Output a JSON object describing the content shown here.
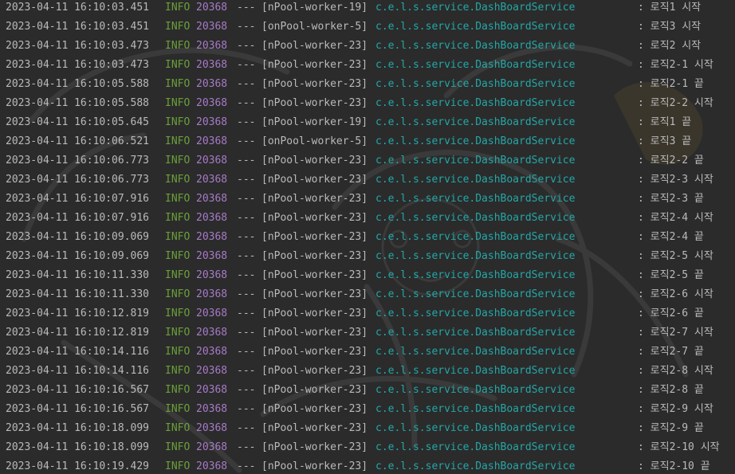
{
  "log": {
    "lines": [
      {
        "timestamp": "2023-04-11 16:10:03.451",
        "level": "INFO",
        "pid": "20368",
        "sep": "---",
        "thread": "[nPool-worker-19]",
        "logger": "c.e.l.s.service.DashBoardService",
        "message": ": 로직1 시작"
      },
      {
        "timestamp": "2023-04-11 16:10:03.451",
        "level": "INFO",
        "pid": "20368",
        "sep": "---",
        "thread": "[onPool-worker-5]",
        "logger": "c.e.l.s.service.DashBoardService",
        "message": ": 로직3 시작"
      },
      {
        "timestamp": "2023-04-11 16:10:03.473",
        "level": "INFO",
        "pid": "20368",
        "sep": "---",
        "thread": "[nPool-worker-23]",
        "logger": "c.e.l.s.service.DashBoardService",
        "message": ": 로직2 시작"
      },
      {
        "timestamp": "2023-04-11 16:10:03.473",
        "level": "INFO",
        "pid": "20368",
        "sep": "---",
        "thread": "[nPool-worker-23]",
        "logger": "c.e.l.s.service.DashBoardService",
        "message": ": 로직2-1 시작"
      },
      {
        "timestamp": "2023-04-11 16:10:05.588",
        "level": "INFO",
        "pid": "20368",
        "sep": "---",
        "thread": "[nPool-worker-23]",
        "logger": "c.e.l.s.service.DashBoardService",
        "message": ": 로직2-1 끝"
      },
      {
        "timestamp": "2023-04-11 16:10:05.588",
        "level": "INFO",
        "pid": "20368",
        "sep": "---",
        "thread": "[nPool-worker-23]",
        "logger": "c.e.l.s.service.DashBoardService",
        "message": ": 로직2-2 시작"
      },
      {
        "timestamp": "2023-04-11 16:10:05.645",
        "level": "INFO",
        "pid": "20368",
        "sep": "---",
        "thread": "[nPool-worker-19]",
        "logger": "c.e.l.s.service.DashBoardService",
        "message": ": 로직1 끝"
      },
      {
        "timestamp": "2023-04-11 16:10:06.521",
        "level": "INFO",
        "pid": "20368",
        "sep": "---",
        "thread": "[onPool-worker-5]",
        "logger": "c.e.l.s.service.DashBoardService",
        "message": ": 로직3 끝"
      },
      {
        "timestamp": "2023-04-11 16:10:06.773",
        "level": "INFO",
        "pid": "20368",
        "sep": "---",
        "thread": "[nPool-worker-23]",
        "logger": "c.e.l.s.service.DashBoardService",
        "message": ": 로직2-2 끝"
      },
      {
        "timestamp": "2023-04-11 16:10:06.773",
        "level": "INFO",
        "pid": "20368",
        "sep": "---",
        "thread": "[nPool-worker-23]",
        "logger": "c.e.l.s.service.DashBoardService",
        "message": ": 로직2-3 시작"
      },
      {
        "timestamp": "2023-04-11 16:10:07.916",
        "level": "INFO",
        "pid": "20368",
        "sep": "---",
        "thread": "[nPool-worker-23]",
        "logger": "c.e.l.s.service.DashBoardService",
        "message": ": 로직2-3 끝"
      },
      {
        "timestamp": "2023-04-11 16:10:07.916",
        "level": "INFO",
        "pid": "20368",
        "sep": "---",
        "thread": "[nPool-worker-23]",
        "logger": "c.e.l.s.service.DashBoardService",
        "message": ": 로직2-4 시작"
      },
      {
        "timestamp": "2023-04-11 16:10:09.069",
        "level": "INFO",
        "pid": "20368",
        "sep": "---",
        "thread": "[nPool-worker-23]",
        "logger": "c.e.l.s.service.DashBoardService",
        "message": ": 로직2-4 끝"
      },
      {
        "timestamp": "2023-04-11 16:10:09.069",
        "level": "INFO",
        "pid": "20368",
        "sep": "---",
        "thread": "[nPool-worker-23]",
        "logger": "c.e.l.s.service.DashBoardService",
        "message": ": 로직2-5 시작"
      },
      {
        "timestamp": "2023-04-11 16:10:11.330",
        "level": "INFO",
        "pid": "20368",
        "sep": "---",
        "thread": "[nPool-worker-23]",
        "logger": "c.e.l.s.service.DashBoardService",
        "message": ": 로직2-5 끝"
      },
      {
        "timestamp": "2023-04-11 16:10:11.330",
        "level": "INFO",
        "pid": "20368",
        "sep": "---",
        "thread": "[nPool-worker-23]",
        "logger": "c.e.l.s.service.DashBoardService",
        "message": ": 로직2-6 시작"
      },
      {
        "timestamp": "2023-04-11 16:10:12.819",
        "level": "INFO",
        "pid": "20368",
        "sep": "---",
        "thread": "[nPool-worker-23]",
        "logger": "c.e.l.s.service.DashBoardService",
        "message": ": 로직2-6 끝"
      },
      {
        "timestamp": "2023-04-11 16:10:12.819",
        "level": "INFO",
        "pid": "20368",
        "sep": "---",
        "thread": "[nPool-worker-23]",
        "logger": "c.e.l.s.service.DashBoardService",
        "message": ": 로직2-7 시작"
      },
      {
        "timestamp": "2023-04-11 16:10:14.116",
        "level": "INFO",
        "pid": "20368",
        "sep": "---",
        "thread": "[nPool-worker-23]",
        "logger": "c.e.l.s.service.DashBoardService",
        "message": ": 로직2-7 끝"
      },
      {
        "timestamp": "2023-04-11 16:10:14.116",
        "level": "INFO",
        "pid": "20368",
        "sep": "---",
        "thread": "[nPool-worker-23]",
        "logger": "c.e.l.s.service.DashBoardService",
        "message": ": 로직2-8 시작"
      },
      {
        "timestamp": "2023-04-11 16:10:16.567",
        "level": "INFO",
        "pid": "20368",
        "sep": "---",
        "thread": "[nPool-worker-23]",
        "logger": "c.e.l.s.service.DashBoardService",
        "message": ": 로직2-8 끝"
      },
      {
        "timestamp": "2023-04-11 16:10:16.567",
        "level": "INFO",
        "pid": "20368",
        "sep": "---",
        "thread": "[nPool-worker-23]",
        "logger": "c.e.l.s.service.DashBoardService",
        "message": ": 로직2-9 시작"
      },
      {
        "timestamp": "2023-04-11 16:10:18.099",
        "level": "INFO",
        "pid": "20368",
        "sep": "---",
        "thread": "[nPool-worker-23]",
        "logger": "c.e.l.s.service.DashBoardService",
        "message": ": 로직2-9 끝"
      },
      {
        "timestamp": "2023-04-11 16:10:18.099",
        "level": "INFO",
        "pid": "20368",
        "sep": "---",
        "thread": "[nPool-worker-23]",
        "logger": "c.e.l.s.service.DashBoardService",
        "message": ": 로직2-10 시작"
      },
      {
        "timestamp": "2023-04-11 16:10:19.429",
        "level": "INFO",
        "pid": "20368",
        "sep": "---",
        "thread": "[nPool-worker-23]",
        "logger": "c.e.l.s.service.DashBoardService",
        "message": ": 로직2-10 끝"
      }
    ]
  },
  "colors": {
    "background": "#2b2b2b",
    "text": "#bababa",
    "level_info": "#6a9f3a",
    "pid": "#a77bc7",
    "logger": "#25a6a6"
  }
}
